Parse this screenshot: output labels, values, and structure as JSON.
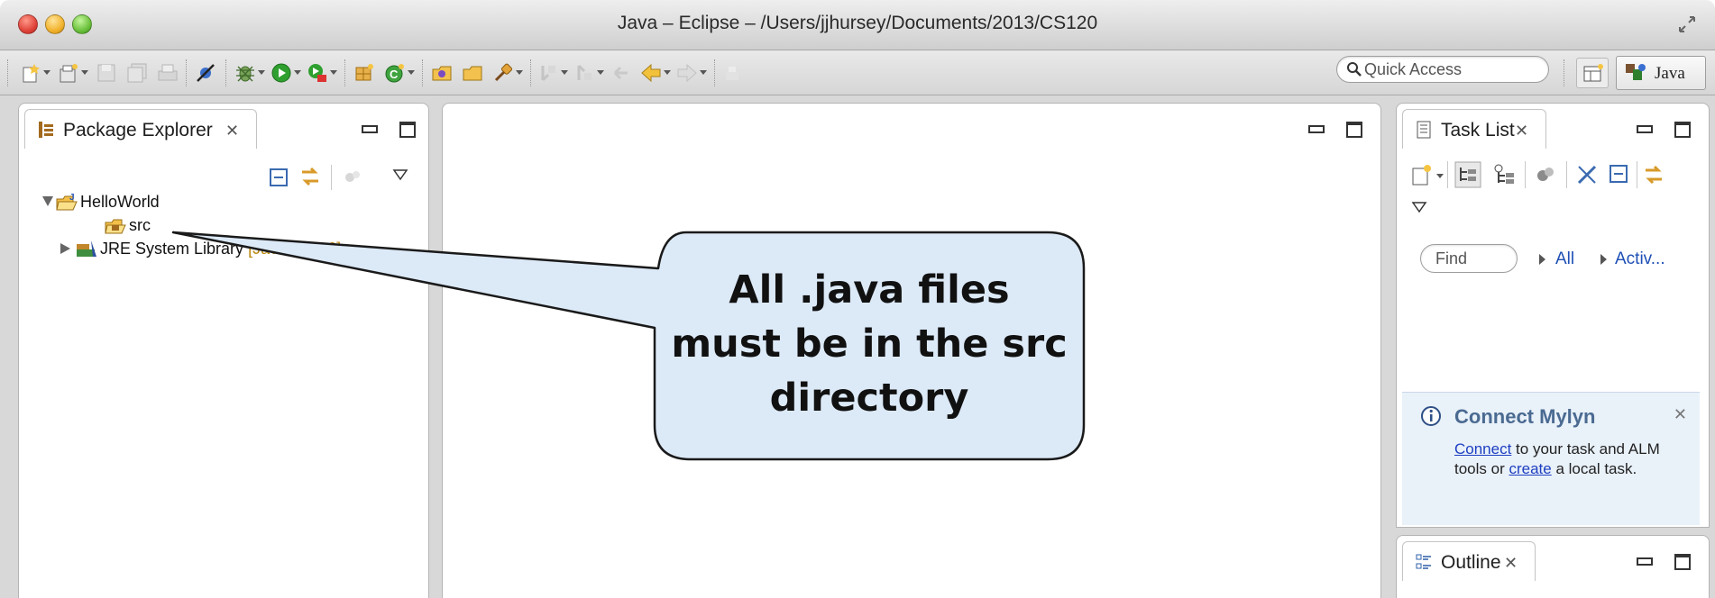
{
  "window": {
    "title": "Java – Eclipse – /Users/jjhursey/Documents/2013/CS120"
  },
  "toolbar": {
    "quick_access_placeholder": "Quick Access",
    "perspective_label": "Java"
  },
  "package_explorer": {
    "tab_label": "Package Explorer",
    "tree": [
      {
        "label": "HelloWorld",
        "expanded": true,
        "icon": "java-project-icon"
      },
      {
        "label": "src",
        "icon": "source-folder-icon"
      },
      {
        "label": "JRE System Library",
        "decoration": "[JavaSE-1.6]",
        "expanded": false,
        "icon": "library-icon"
      }
    ]
  },
  "task_list": {
    "tab_label": "Task List",
    "find_placeholder": "Find",
    "filters": [
      "All",
      "Activ..."
    ]
  },
  "mylyn": {
    "title": "Connect Mylyn",
    "connect_link": "Connect",
    "text_1": " to your task and ALM tools or ",
    "create_link": "create",
    "text_2": " a local task."
  },
  "outline": {
    "tab_label": "Outline"
  },
  "callout": {
    "line1": "All .java files",
    "line2": "must be in the src",
    "line3": "directory"
  },
  "colors": {
    "callout_fill": "#dce9f7",
    "link": "#1d3fc2",
    "mylyn_title": "#4a6a91",
    "decoration": "#b8860b"
  }
}
